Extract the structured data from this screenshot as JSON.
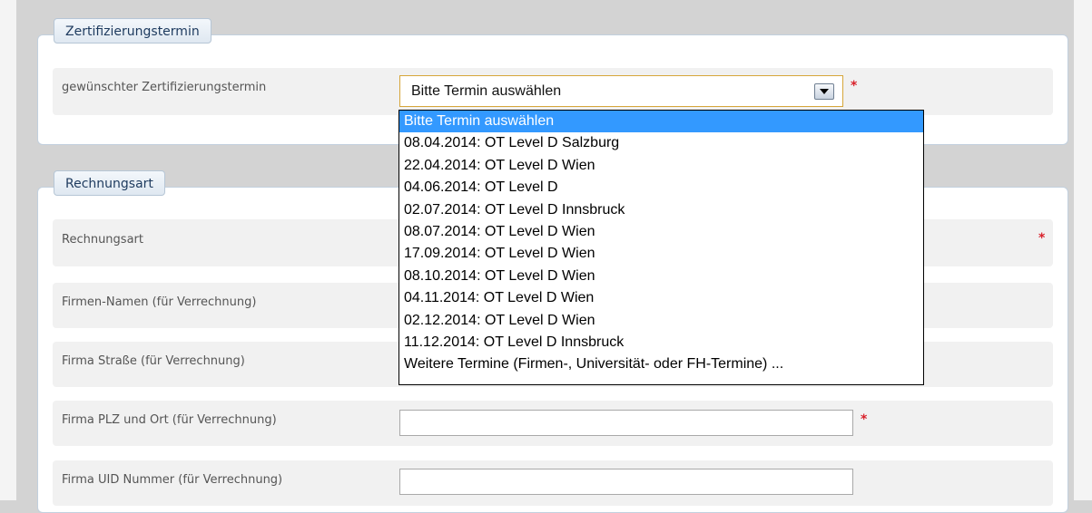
{
  "section_termin": {
    "legend": "Zertifizierungstermin",
    "field_label": "gewünschter Zertifizierungstermin",
    "required_marker": "*",
    "select_value": "Bitte Termin auswählen",
    "options": [
      {
        "label": "Bitte Termin auswählen",
        "selected": true
      },
      {
        "label": "08.04.2014: OT Level D Salzburg",
        "selected": false
      },
      {
        "label": "22.04.2014: OT Level D Wien",
        "selected": false
      },
      {
        "label": "04.06.2014: OT Level D",
        "selected": false
      },
      {
        "label": "02.07.2014: OT Level D Innsbruck",
        "selected": false
      },
      {
        "label": "08.07.2014: OT Level D Wien",
        "selected": false
      },
      {
        "label": "17.09.2014: OT Level D Wien",
        "selected": false
      },
      {
        "label": "08.10.2014: OT Level D Wien",
        "selected": false
      },
      {
        "label": "04.11.2014: OT Level D Wien",
        "selected": false
      },
      {
        "label": "02.12.2014: OT Level D Wien",
        "selected": false
      },
      {
        "label": "11.12.2014: OT Level D Innsbruck",
        "selected": false
      },
      {
        "label": "Weitere Termine (Firmen-, Universität- oder FH-Termine) ...",
        "selected": false
      }
    ]
  },
  "section_rechnung": {
    "legend": "Rechnungsart",
    "fields": {
      "rechnungsart": {
        "label": "Rechnungsart",
        "required_marker": "*"
      },
      "firmen_namen": {
        "label": "Firmen-Namen (für Verrechnung)"
      },
      "firma_strasse": {
        "label": "Firma Straße (für Verrechnung)"
      },
      "firma_plz_ort": {
        "label": "Firma PLZ und Ort (für Verrechnung)",
        "value": "",
        "required_marker": "*"
      },
      "firma_uid": {
        "label": "Firma UID Nummer (für Verrechnung)",
        "value": ""
      }
    }
  },
  "colors": {
    "selected_option_bg": "#3399ff",
    "required_marker": "#d9202a",
    "legend_text": "#1d3a5e",
    "select_focus_border": "#d6a63a"
  }
}
